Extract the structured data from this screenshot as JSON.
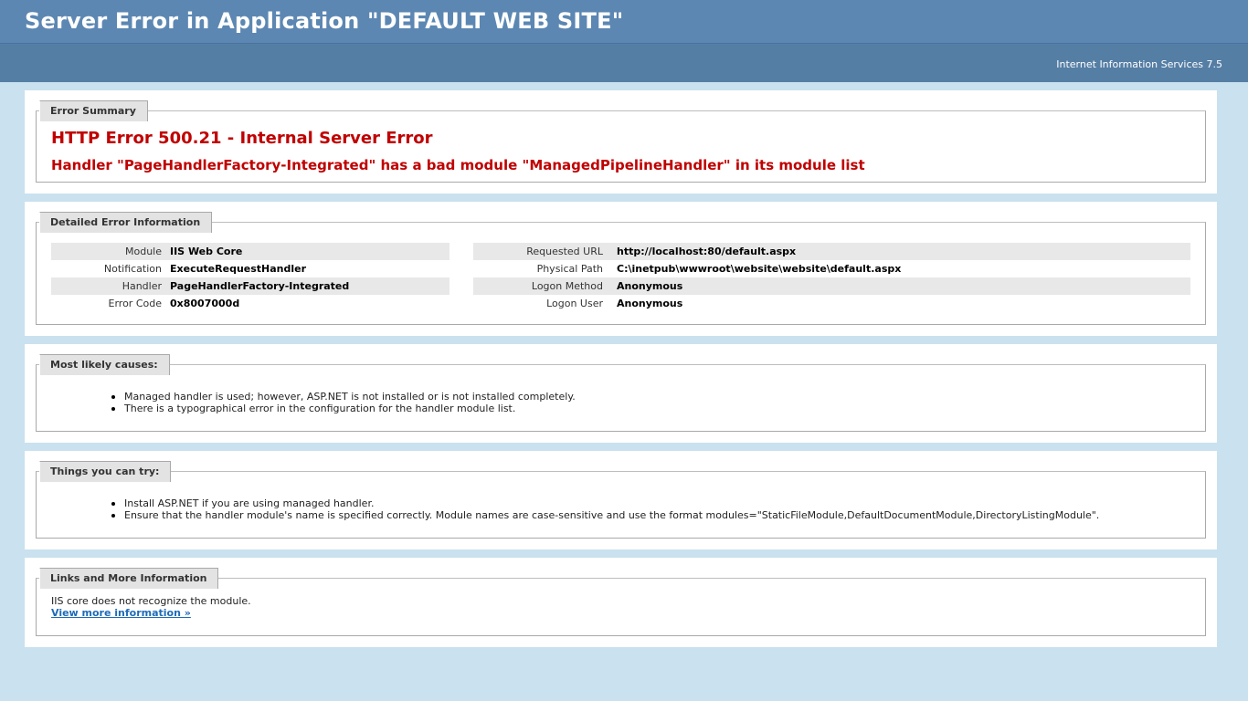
{
  "header": {
    "title": "Server Error in Application \"DEFAULT WEB SITE\"",
    "server": "Internet Information Services 7.5"
  },
  "summary": {
    "legend": "Error Summary",
    "title": "HTTP Error 500.21 - Internal Server Error",
    "message": "Handler \"PageHandlerFactory-Integrated\" has a bad module \"ManagedPipelineHandler\" in its module list"
  },
  "details": {
    "legend": "Detailed Error Information",
    "left": [
      {
        "label": "Module",
        "value": "IIS Web Core"
      },
      {
        "label": "Notification",
        "value": "ExecuteRequestHandler"
      },
      {
        "label": "Handler",
        "value": "PageHandlerFactory-Integrated"
      },
      {
        "label": "Error Code",
        "value": "0x8007000d"
      }
    ],
    "right": [
      {
        "label": "Requested URL",
        "value": "http://localhost:80/default.aspx"
      },
      {
        "label": "Physical Path",
        "value": "C:\\inetpub\\wwwroot\\website\\website\\default.aspx"
      },
      {
        "label": "Logon Method",
        "value": "Anonymous"
      },
      {
        "label": "Logon User",
        "value": "Anonymous"
      }
    ]
  },
  "causes": {
    "legend": "Most likely causes:",
    "items": [
      "Managed handler is used; however, ASP.NET is not installed or is not installed completely.",
      "There is a typographical error in the configuration for the handler module list."
    ]
  },
  "tries": {
    "legend": "Things you can try:",
    "items": [
      "Install ASP.NET if you are using managed handler.",
      "Ensure that the handler module's name is specified correctly. Module names are case-sensitive and use the format modules=\"StaticFileModule,DefaultDocumentModule,DirectoryListingModule\"."
    ]
  },
  "links": {
    "legend": "Links and More Information",
    "text": "IIS core does not recognize the module.",
    "more": "View more information »"
  }
}
